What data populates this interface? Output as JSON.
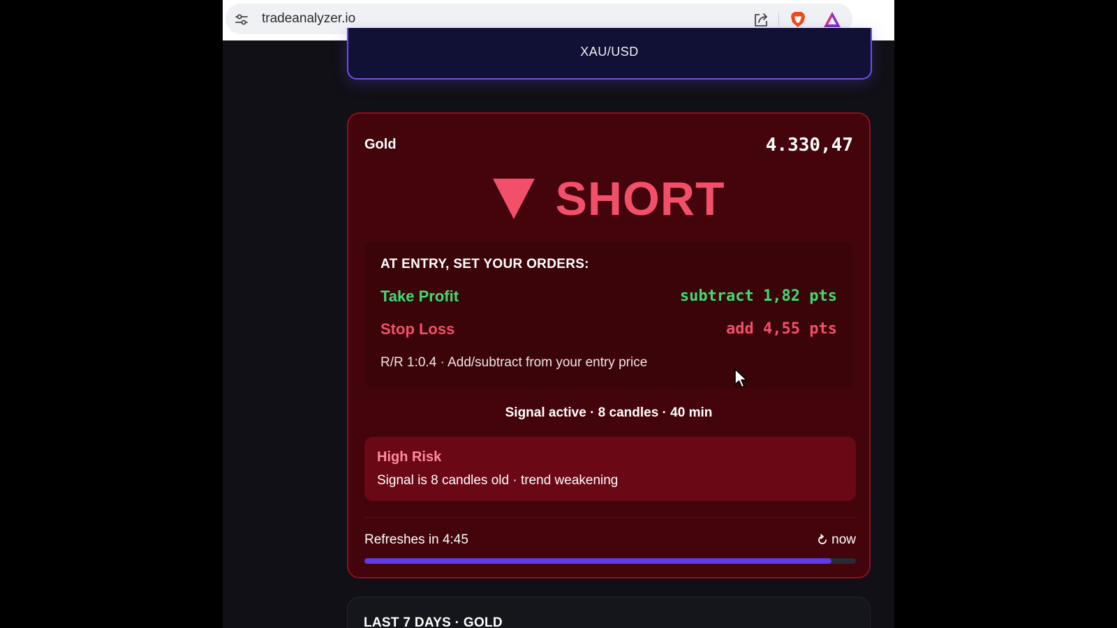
{
  "browser": {
    "url": "tradeanalyzer.io",
    "icons": [
      "site-settings-icon",
      "share-icon",
      "brave-shields-icon",
      "brave-rewards-icon"
    ]
  },
  "symbol": {
    "label": "XAU/USD"
  },
  "signal": {
    "asset_name": "Gold",
    "price": "4.330,47",
    "direction_icon": "triangle-down-icon",
    "direction_label": "SHORT",
    "orders_title": "AT ENTRY, SET YOUR ORDERS:",
    "take_profit_label": "Take Profit",
    "take_profit_value": "subtract 1,82 pts",
    "stop_loss_label": "Stop Loss",
    "stop_loss_value": "add 4,55 pts",
    "rr_note": "R/R 1:0.4 · Add/subtract from your entry price",
    "status": "Signal active · 8 candles · 40 min",
    "risk_title": "High Risk",
    "risk_description": "Signal is 8 candles old · trend weakening",
    "refresh_text": "Refreshes in 4:45",
    "refresh_now_label": "now",
    "refresh_progress": 0.95
  },
  "history": {
    "title": "LAST 7 DAYS · GOLD"
  },
  "colors": {
    "short": "#f2506a",
    "take_profit": "#3fdc6f",
    "accent": "#5b3ce6",
    "card_bg": "#43040b",
    "risk_bg": "#6b0816"
  }
}
